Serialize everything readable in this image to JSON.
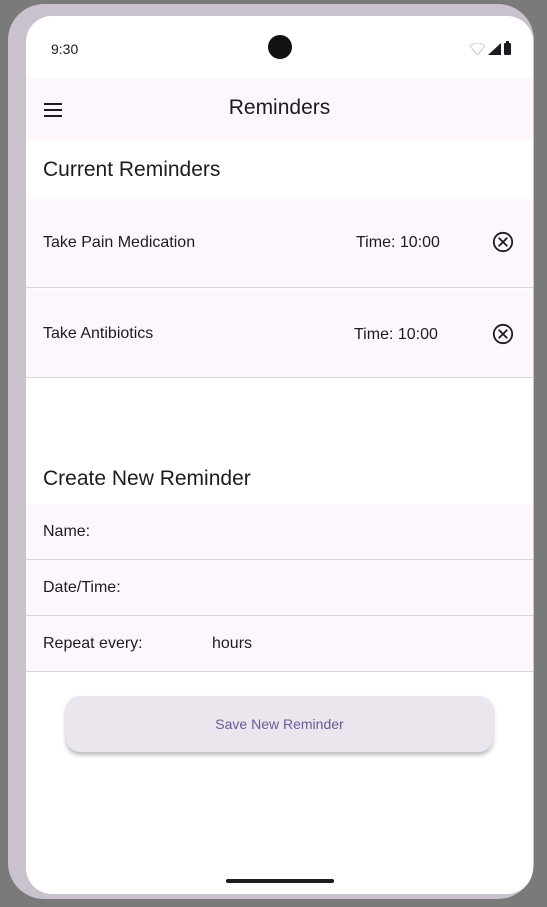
{
  "status_bar": {
    "time": "9:30",
    "icons": [
      "wifi-icon",
      "cellular-signal-icon",
      "battery-icon"
    ]
  },
  "app_bar": {
    "title": "Reminders",
    "menu_icon": "hamburger-menu-icon"
  },
  "current_reminders": {
    "heading": "Current Reminders",
    "items": [
      {
        "name": "Take Pain Medication",
        "time": "Time: 10:00",
        "remove_icon": "circle-x-icon"
      },
      {
        "name": "Take Antibiotics",
        "time": "Time: 10:00",
        "remove_icon": "circle-x-icon"
      }
    ]
  },
  "create_reminder": {
    "heading": "Create New Reminder",
    "name_label": "Name:",
    "name_value": "",
    "datetime_label": "Date/Time:",
    "datetime_value": "",
    "repeat_label": "Repeat every:",
    "repeat_value": "",
    "repeat_unit": "hours",
    "save_label": "Save New Reminder"
  },
  "colors": {
    "surface": "#fdf7fd",
    "button_bg": "#ebe5ee",
    "button_text": "#6a5a94",
    "divider": "#d9d3da",
    "frame": "#c9c2cc"
  }
}
